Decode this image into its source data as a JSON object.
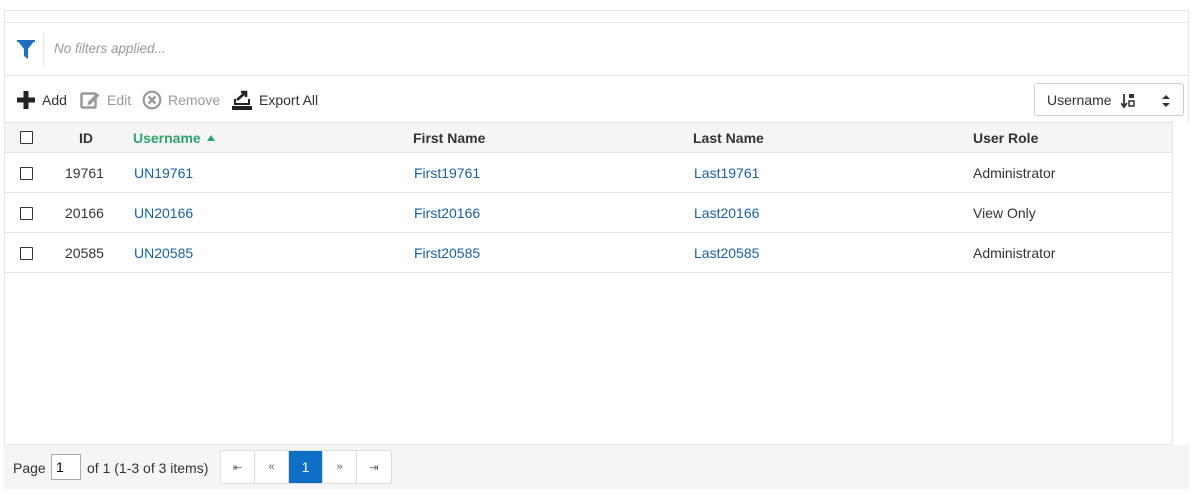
{
  "filter": {
    "text": "No filters applied..."
  },
  "toolbar": {
    "add_label": "Add",
    "edit_label": "Edit",
    "remove_label": "Remove",
    "export_label": "Export All"
  },
  "sort_select": {
    "value": "Username"
  },
  "grid": {
    "columns": {
      "id": "ID",
      "username": "Username",
      "first_name": "First Name",
      "last_name": "Last Name",
      "user_role": "User Role"
    },
    "rows": [
      {
        "id": "19761",
        "username": "UN19761",
        "first_name": "First19761",
        "last_name": "Last19761",
        "user_role": "Administrator"
      },
      {
        "id": "20166",
        "username": "UN20166",
        "first_name": "First20166",
        "last_name": "Last20166",
        "user_role": "View Only"
      },
      {
        "id": "20585",
        "username": "UN20585",
        "first_name": "First20585",
        "last_name": "Last20585",
        "user_role": "Administrator"
      }
    ]
  },
  "pager": {
    "page_label": "Page",
    "page_value": "1",
    "summary": "of 1 (1-3 of 3 items)",
    "first": "⇤",
    "prev": "«",
    "current": "1",
    "next": "»",
    "last": "⇥"
  },
  "colors": {
    "accent": "#0f6fc6",
    "link": "#1a5fa0",
    "sorted": "#2fa36f"
  }
}
